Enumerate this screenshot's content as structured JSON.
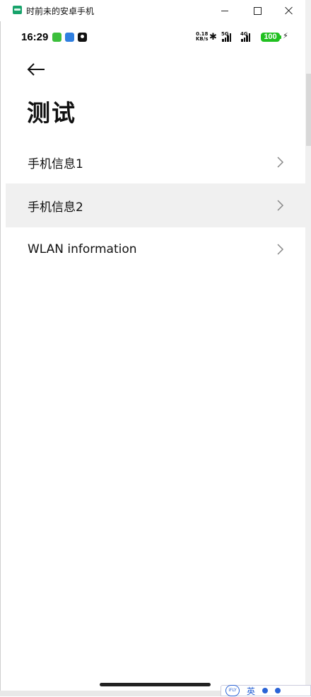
{
  "window": {
    "title": "时前未的安卓手机",
    "min_icon": "minimize-icon",
    "max_icon": "maximize-icon",
    "close_icon": "close-icon"
  },
  "status_bar": {
    "time": "16:29",
    "net_speed_value": "0.18",
    "net_speed_unit": "KB/s",
    "sig1_label": "5G",
    "sig2_label": "4G",
    "battery": "100",
    "bluetooth_glyph": "✱",
    "charge_glyph": "⚡"
  },
  "page": {
    "title": "测试",
    "items": [
      {
        "label": "手机信息1"
      },
      {
        "label": "手机信息2"
      },
      {
        "label": "WLAN information"
      }
    ]
  },
  "ime": {
    "logo": "iFLY",
    "mode": "英"
  },
  "colors": {
    "highlight_row": "#f0f0f0",
    "battery": "#20c020",
    "text": "#111111"
  }
}
